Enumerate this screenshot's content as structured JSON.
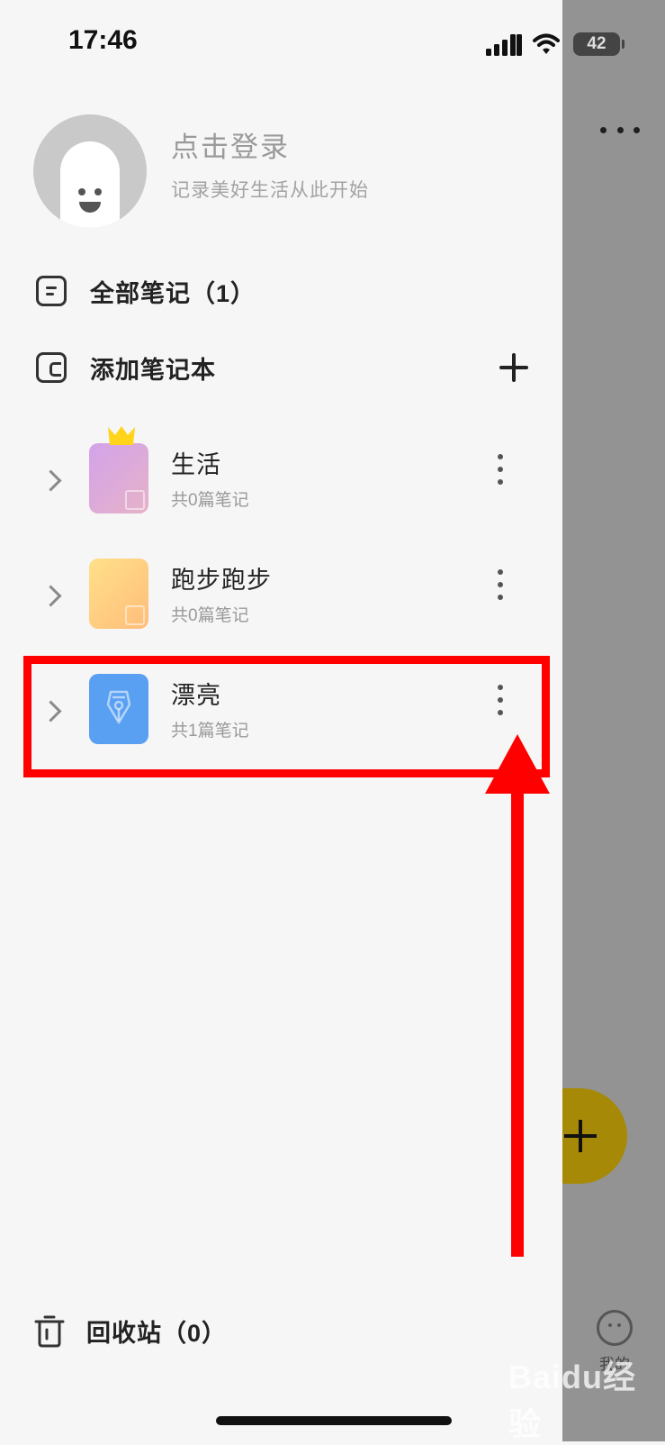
{
  "status_bar": {
    "time": "17:46",
    "battery": "42"
  },
  "profile": {
    "login_title": "点击登录",
    "login_subtitle": "记录美好生活从此开始"
  },
  "menu": {
    "all_notes_label": "全部笔记（1）",
    "add_notebook_label": "添加笔记本"
  },
  "notebooks": [
    {
      "name": "生活",
      "count": "共0篇笔记",
      "cover": "purple-gradient",
      "badge": "crown-icon"
    },
    {
      "name": "跑步跑步",
      "count": "共0篇笔记",
      "cover": "orange-gradient"
    },
    {
      "name": "漂亮",
      "count": "共1篇笔记",
      "cover": "blue",
      "cover_icon": "fountain-pen-icon"
    }
  ],
  "trash": {
    "label": "回收站（0）"
  },
  "background": {
    "tab_label": "我的",
    "watermark": "Baidu经验"
  },
  "colors": {
    "annotation_red": "#ff0000",
    "fab_yellow": "#a68a07",
    "dim_overlay": "#939393"
  }
}
